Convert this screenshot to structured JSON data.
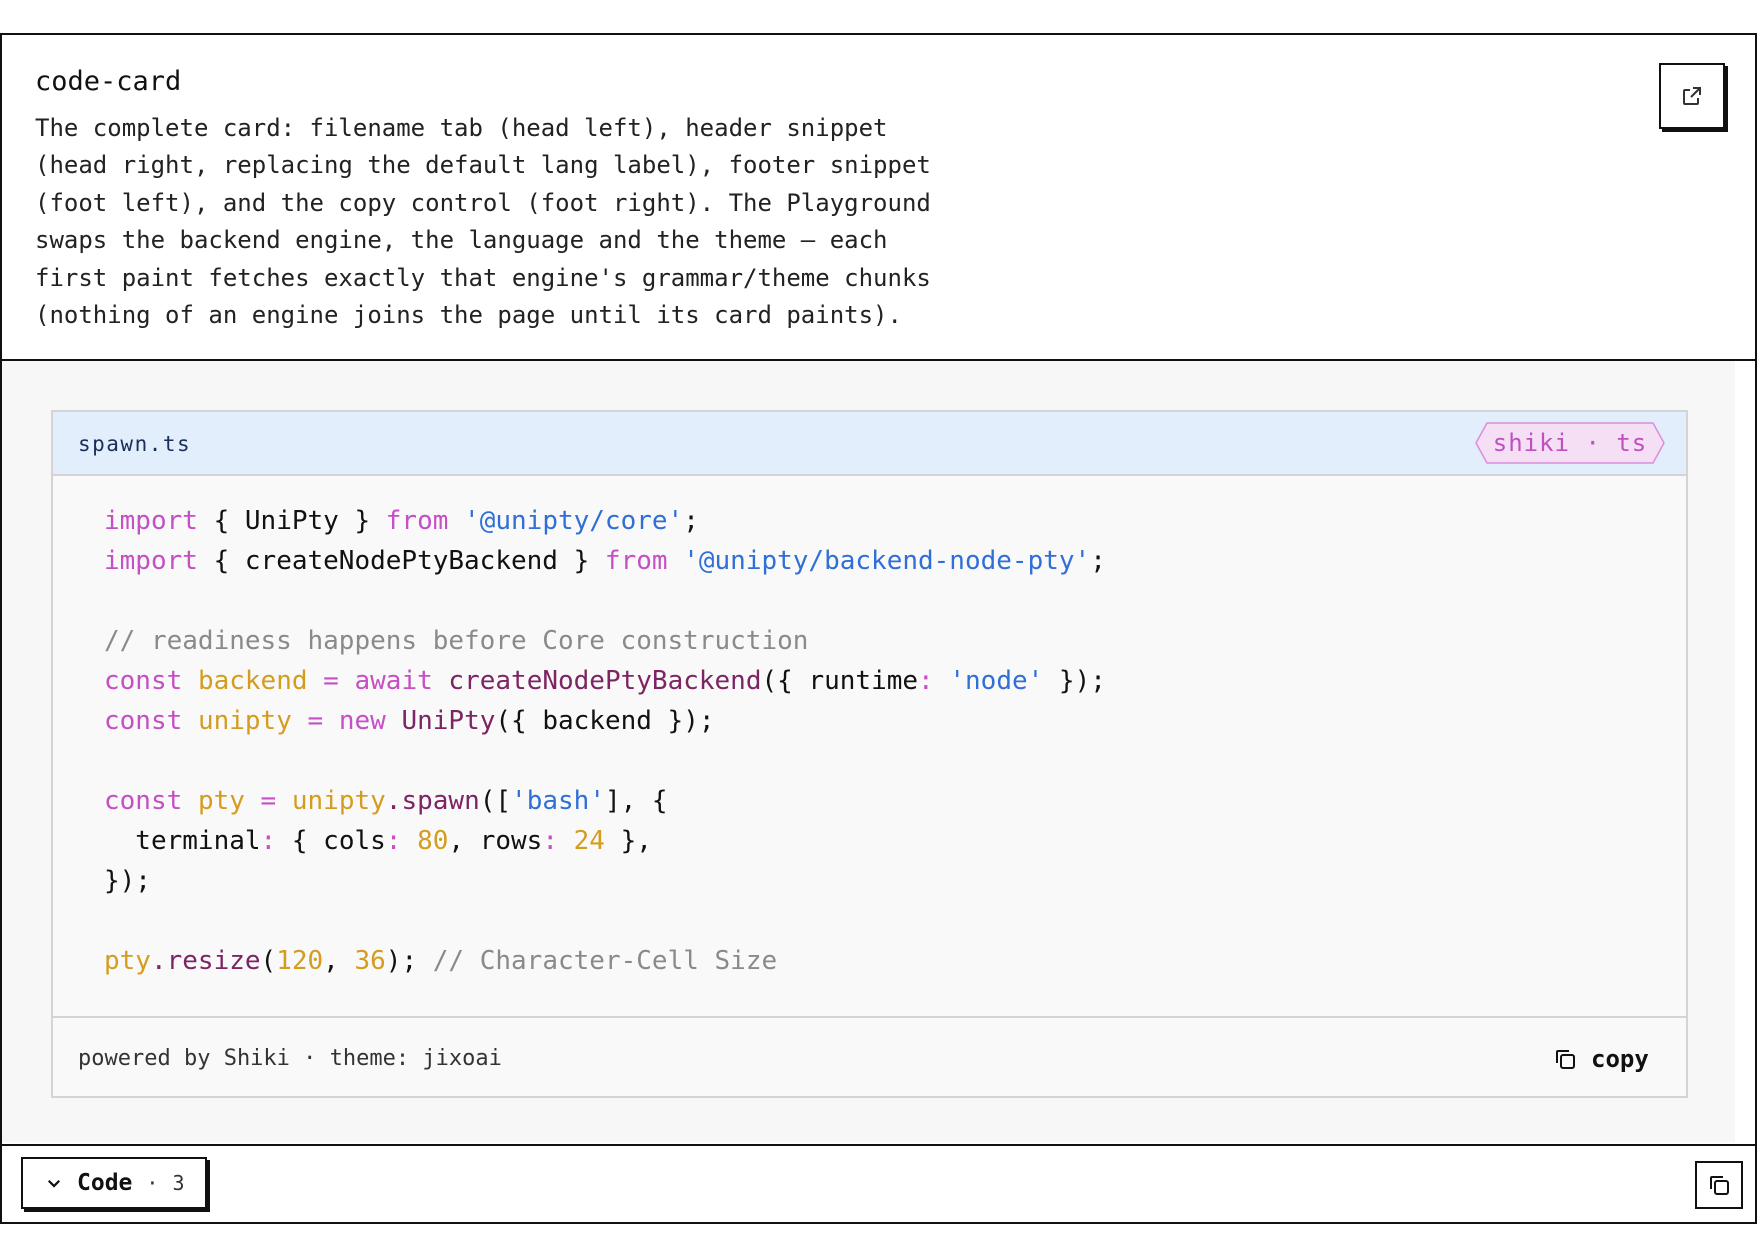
{
  "intro": {
    "title": "code-card",
    "description": "The complete card: filename tab (head left), header snippet\n(head right, replacing the default lang label), footer snippet\n(foot left), and the copy control (foot right). The Playground\nswaps the backend engine, the language and the theme — each\nfirst paint fetches exactly that engine's grammar/theme chunks\n(nothing of an engine joins the page until its card paints).",
    "open_icon": "external-link-icon"
  },
  "card": {
    "filename": "spawn.ts",
    "lang_badge": "shiki · ts",
    "code": {
      "l1": {
        "a": "import",
        "b": " { UniPty } ",
        "c": "from",
        "d": " ",
        "e": "'@unipty/core'",
        "f": ";"
      },
      "l2": {
        "a": "import",
        "b": " { createNodePtyBackend } ",
        "c": "from",
        "d": " ",
        "e": "'@unipty/backend-node-pty'",
        "f": ";"
      },
      "l3": {
        "a": "// readiness happens before Core construction"
      },
      "l4": {
        "a": "const",
        "b": " ",
        "c": "backend",
        "d": " = ",
        "e": "await",
        "f": " ",
        "g": "createNodePtyBackend",
        "h": "({ runtime",
        "i": ":",
        "j": " ",
        "k": "'node'",
        "l": " });"
      },
      "l5": {
        "a": "const",
        "b": " ",
        "c": "unipty",
        "d": " = ",
        "e": "new",
        "f": " ",
        "g": "UniPty",
        "h": "({ backend });"
      },
      "l6": {
        "a": "const",
        "b": " ",
        "c": "pty",
        "d": " = ",
        "e": "unipty",
        "f": ".",
        "g": "spawn",
        "h": "([",
        "i": "'bash'",
        "j": "], {"
      },
      "l7": {
        "a": "  terminal",
        "b": ":",
        "c": " { cols",
        "d": ":",
        "e": " ",
        "f": "80",
        "g": ", rows",
        "h": ":",
        "i": " ",
        "j": "24",
        "k": " },"
      },
      "l8": {
        "a": "});"
      },
      "l9": {
        "a": "pty",
        "b": ".",
        "c": "resize",
        "d": "(",
        "e": "120",
        "f": ", ",
        "g": "36",
        "h": "); ",
        "i": "// Character-Cell Size"
      }
    },
    "footer": {
      "powered": "powered by Shiki · theme: jixoai",
      "copy_label": "copy",
      "copy_icon": "copy-icon"
    }
  },
  "toolbar": {
    "toggle_icon": "chevron-down-icon",
    "code_label": "Code",
    "separator": "·",
    "count": "3",
    "copy_all_icon": "copy-icon"
  },
  "colors": {
    "keyword": "#c54fc5",
    "string": "#2f6fd6",
    "comment": "#8a8a8a",
    "variable": "#d49d1f",
    "function": "#7d2463",
    "header_bg": "#e3eefd"
  }
}
